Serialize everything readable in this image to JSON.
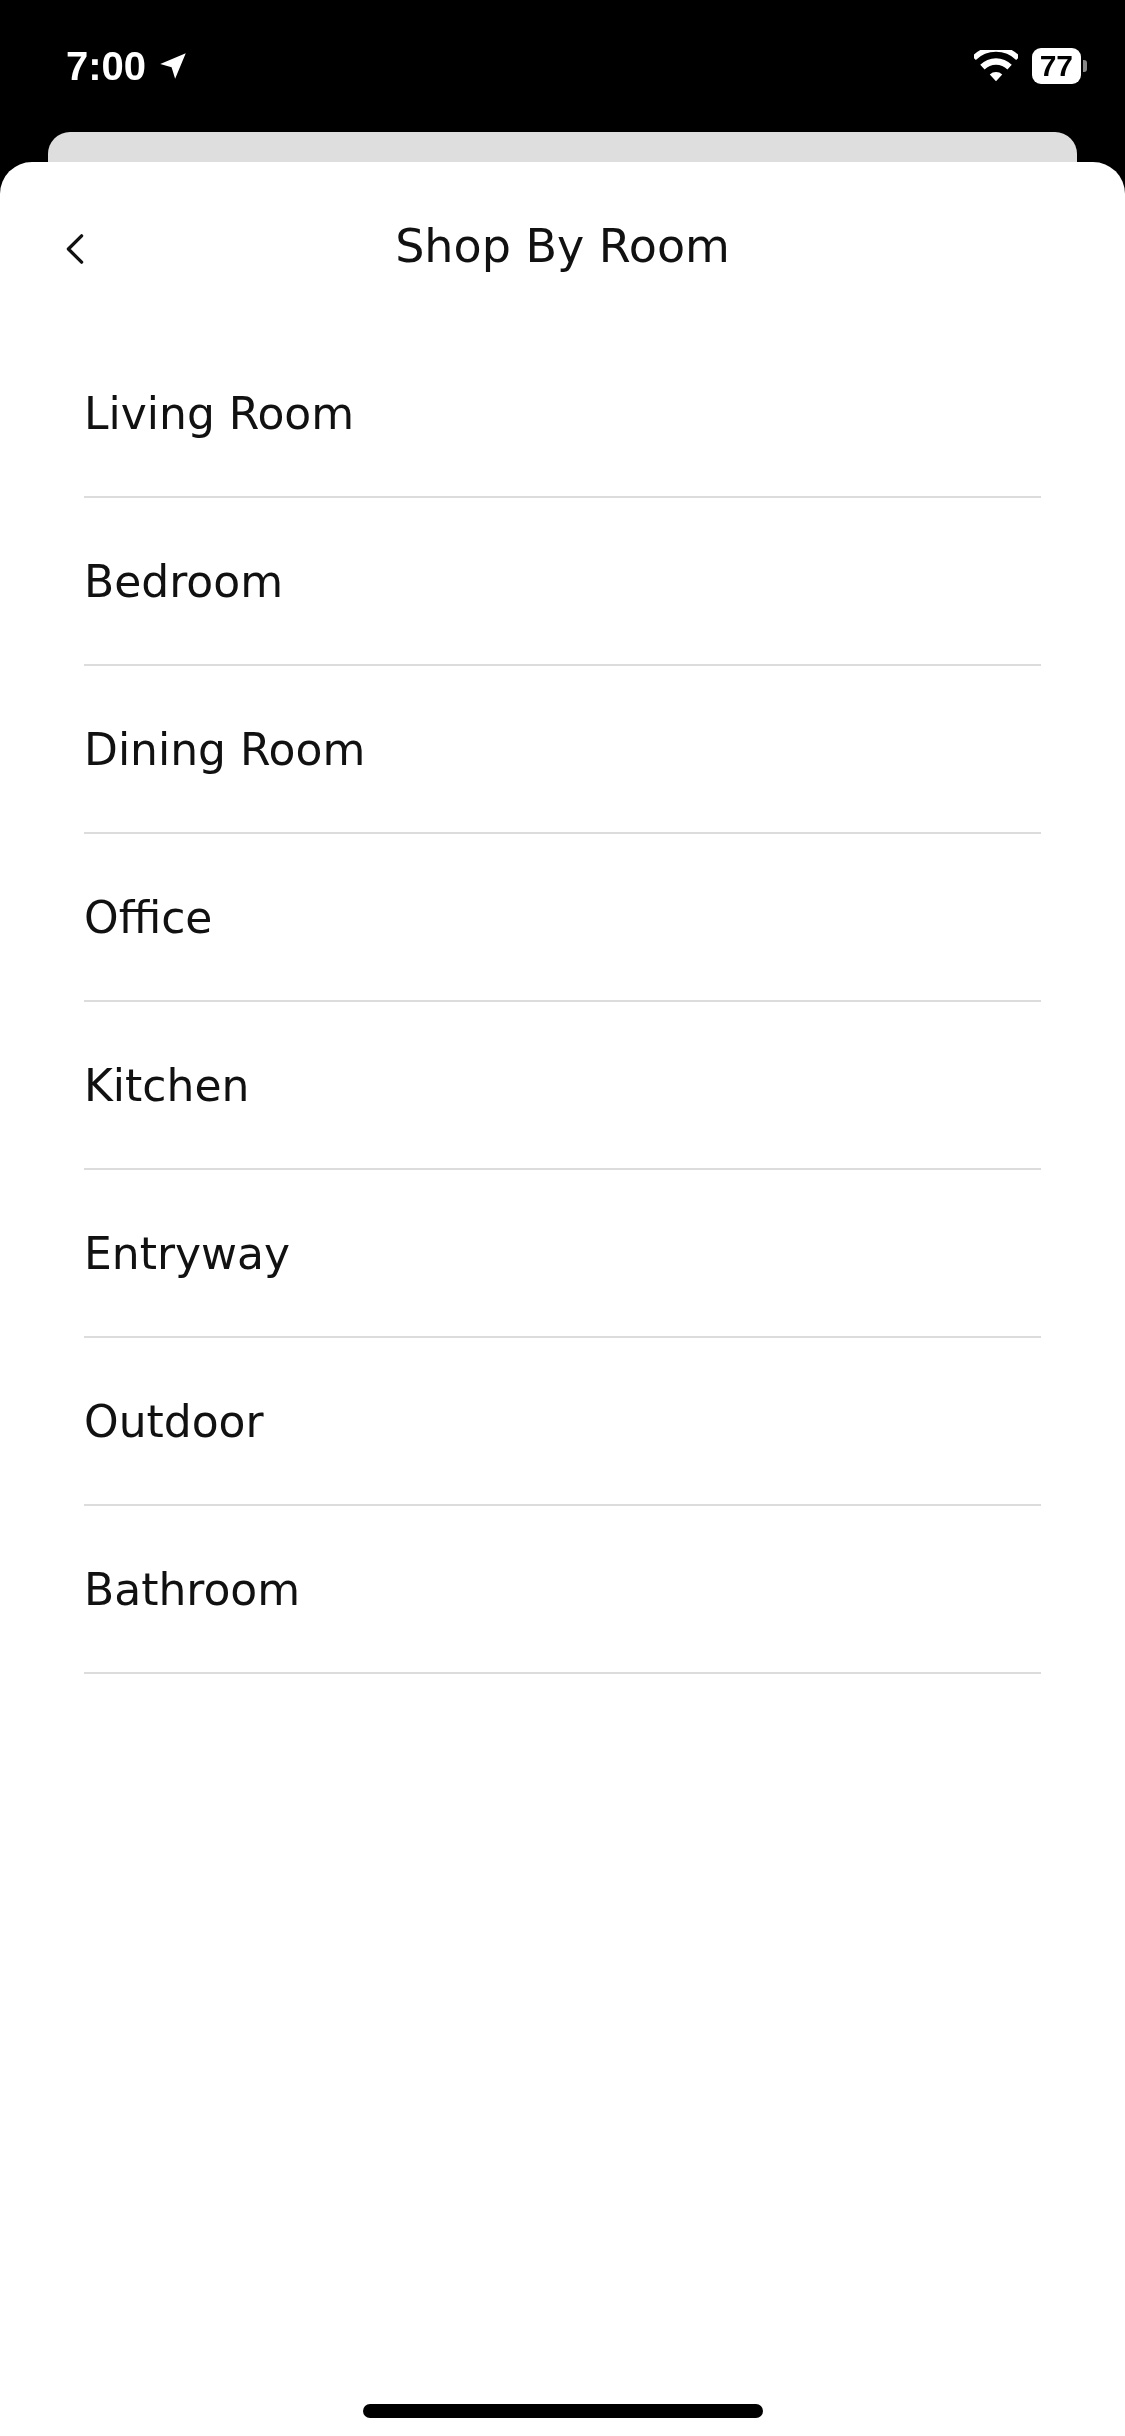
{
  "status_bar": {
    "time": "7:00",
    "battery": "77"
  },
  "header": {
    "title": "Shop By Room"
  },
  "rooms": [
    "Living Room",
    "Bedroom",
    "Dining Room",
    "Office",
    "Kitchen",
    "Entryway",
    "Outdoor",
    "Bathroom"
  ]
}
